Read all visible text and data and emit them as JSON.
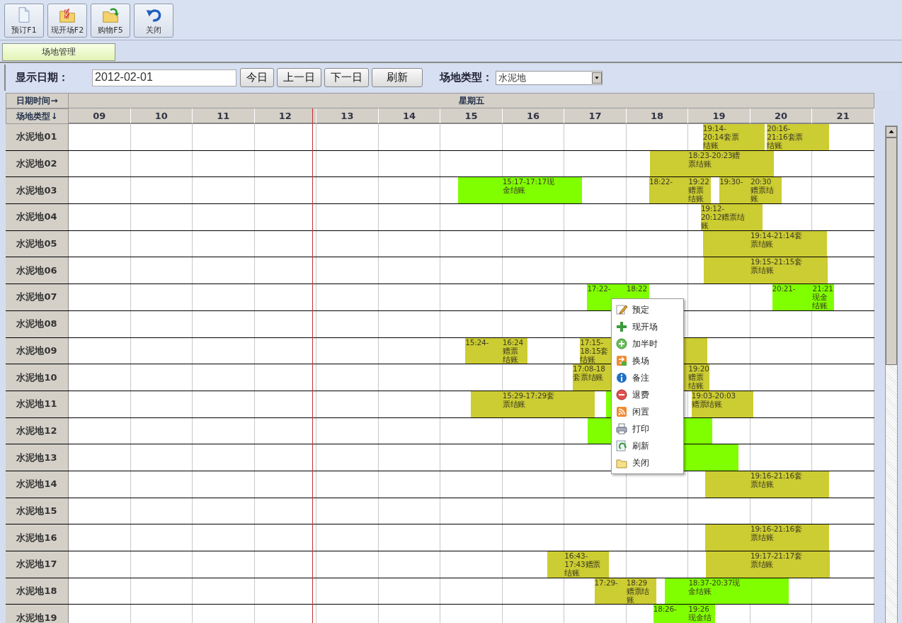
{
  "toolbar": [
    "预订F1",
    "现开场F2",
    "购物F5",
    "关闭"
  ],
  "tabs": [
    {
      "label": "场地管理",
      "selected": true
    }
  ],
  "filter": {
    "date_label": "显示日期：",
    "date_value": "2012-02-01",
    "buttons": [
      "今日",
      "上一日",
      "下一日",
      "刷新"
    ],
    "type_label": "场地类型：",
    "type_value": "水泥地"
  },
  "grid": {
    "date_header": "日期时间→",
    "court_header": "场地类型↓",
    "day": "星期五",
    "hours": [
      "09",
      "10",
      "11",
      "12",
      "13",
      "14",
      "15",
      "16",
      "17",
      "18",
      "19",
      "20",
      "21"
    ],
    "now": {
      "level": 0.302
    },
    "rows": [
      {
        "name": "水泥地01",
        "bookings": [
          {
            "kind": "label-start",
            "color": "#cccc33",
            "pieces": [
              [
                "19:14-",
                "20:14套票",
                "结账"
              ]
            ]
          },
          {
            "kind": "label-start",
            "color": "#cccc33",
            "pieces": [
              [
                "20:16-",
                "21:16套票",
                "结账"
              ]
            ]
          }
        ]
      },
      {
        "name": "水泥地02",
        "bookings": [
          {
            "kind": "label-next-hour",
            "color": "#cccc33",
            "pieces": [
              [
                "18:23-20:23赠",
                "票结账"
              ]
            ]
          }
        ]
      },
      {
        "name": "水泥地03",
        "bookings": [
          {
            "kind": "label-next-hour",
            "color": "#80ff00",
            "pieces": [
              [
                "15:17-17:17现",
                "金结账"
              ]
            ]
          },
          {
            "kind": "label-start",
            "color": "#cccc33",
            "pieces": [
              [
                "18:22-"
              ],
              [
                "19:22",
                "赠票",
                "结账"
              ]
            ]
          },
          {
            "kind": "label-start",
            "color": "#cccc33",
            "pieces": [
              [
                "19:30-"
              ],
              [
                "20:30",
                "赠票结",
                "账"
              ]
            ]
          }
        ]
      },
      {
        "name": "水泥地04",
        "bookings": [
          {
            "kind": "label-start",
            "color": "#cccc33",
            "pieces": [
              [
                "19:12-",
                "20:12赠票结",
                "账"
              ]
            ]
          }
        ]
      },
      {
        "name": "水泥地05",
        "bookings": [
          {
            "kind": "label-next-hour",
            "color": "#cccc33",
            "pieces": [
              [
                "19:14-21:14套",
                "票结账"
              ]
            ]
          }
        ]
      },
      {
        "name": "水泥地06",
        "bookings": [
          {
            "kind": "label-next-hour",
            "color": "#cccc33",
            "pieces": [
              [
                "19:15-21:15套",
                "票结账"
              ]
            ]
          }
        ]
      },
      {
        "name": "水泥地07",
        "bookings": [
          {
            "kind": "label-start",
            "color": "#80ff00",
            "pieces": [
              [
                "17:22-"
              ],
              [
                "18:22"
              ]
            ]
          },
          {
            "kind": "label-start",
            "color": "#80ff00",
            "pieces": [
              [
                "20:21-"
              ],
              [
                "21:21",
                "现金",
                "结账"
              ]
            ]
          }
        ]
      },
      {
        "name": "水泥地08",
        "bookings": []
      },
      {
        "name": "水泥地09",
        "bookings": [
          {
            "kind": "label-start",
            "color": "#cccc33",
            "pieces": [
              [
                "15:24-"
              ],
              [
                "16:24",
                "赠票",
                "结账"
              ]
            ]
          },
          {
            "kind": "label-start",
            "color": "#cccc33",
            "pieces": [
              [
                "17:15-",
                "18:15套",
                "结账"
              ]
            ]
          },
          {
            "kind": "unlabelled",
            "color": "#cccc33",
            "start": {
              "level": 0.711
            },
            "end": {
              "level": 0.792
            }
          }
        ]
      },
      {
        "name": "水泥地10",
        "bookings": [
          {
            "kind": "label-start",
            "color": "#cccc33",
            "pieces": [
              [
                "17:08-18",
                "套票结账"
              ]
            ]
          },
          {
            "kind": "label-next-hour",
            "color": "#cccc33",
            "pieces": [
              [
                "19:20",
                "赠票",
                "结账"
              ]
            ]
          }
        ]
      },
      {
        "name": "水泥地11",
        "bookings": [
          {
            "kind": "label-next-hour",
            "color": "#cccc33",
            "pieces": [
              [
                "15:29-17:29套",
                "票结账"
              ]
            ]
          },
          {
            "kind": "unlabelled",
            "color": "#80ff00",
            "start": {
              "level": 0.668
            },
            "end": {
              "level": 0.746
            }
          },
          {
            "kind": "label-start",
            "color": "#cccc33",
            "pieces": [
              [
                "19:03-20:03",
                "赠票结账"
              ]
            ]
          }
        ]
      },
      {
        "name": "水泥地12",
        "bookings": [
          {
            "kind": "unlabelled",
            "color": "#80ff00",
            "start": {
              "level": 0.645
            },
            "end": {
              "level": 0.798
            }
          }
        ]
      },
      {
        "name": "水泥地13",
        "bookings": [
          {
            "kind": "unlabelled",
            "color": "#80ff00",
            "start": {
              "level": 0.679
            },
            "end": {
              "level": 0.83
            }
          }
        ]
      },
      {
        "name": "水泥地14",
        "bookings": [
          {
            "kind": "label-next-hour",
            "color": "#cccc33",
            "pieces": [
              [
                "19:16-21:16套",
                "票结账"
              ]
            ]
          }
        ]
      },
      {
        "name": "水泥地15",
        "bookings": []
      },
      {
        "name": "水泥地16",
        "bookings": [
          {
            "kind": "label-next-hour",
            "color": "#cccc33",
            "pieces": [
              [
                "19:16-21:16套",
                "票结账"
              ]
            ]
          }
        ]
      },
      {
        "name": "水泥地17",
        "bookings": [
          {
            "kind": "label-next-hour",
            "color": "#cccc33",
            "pieces": [
              [
                "16:43-",
                "17:43赠票",
                "结账"
              ]
            ]
          },
          {
            "kind": "label-next-hour",
            "color": "#cccc33",
            "pieces": [
              [
                "19:17-21:17套",
                "票结账"
              ]
            ]
          }
        ]
      },
      {
        "name": "水泥地18",
        "bookings": [
          {
            "kind": "label-start",
            "color": "#cccc33",
            "pieces": [
              [
                "17:29-"
              ],
              [
                "18:29",
                "赠票结",
                "账"
              ]
            ]
          },
          {
            "kind": "label-next-hour",
            "color": "#80ff00",
            "pieces": [
              [
                "18:37-20:37现",
                "金结账"
              ]
            ]
          }
        ]
      },
      {
        "name": "水泥地19",
        "bookings": [
          {
            "kind": "label-start",
            "color": "#80ff00",
            "pieces": [
              [
                "18:26-"
              ],
              [
                "19:26",
                "现金结"
              ]
            ]
          }
        ]
      }
    ]
  },
  "context_menu": [
    "预定",
    "现开场",
    "加半时",
    "换场",
    "备注",
    "退费",
    "闲置",
    "打印",
    "刷新",
    "关闭"
  ]
}
